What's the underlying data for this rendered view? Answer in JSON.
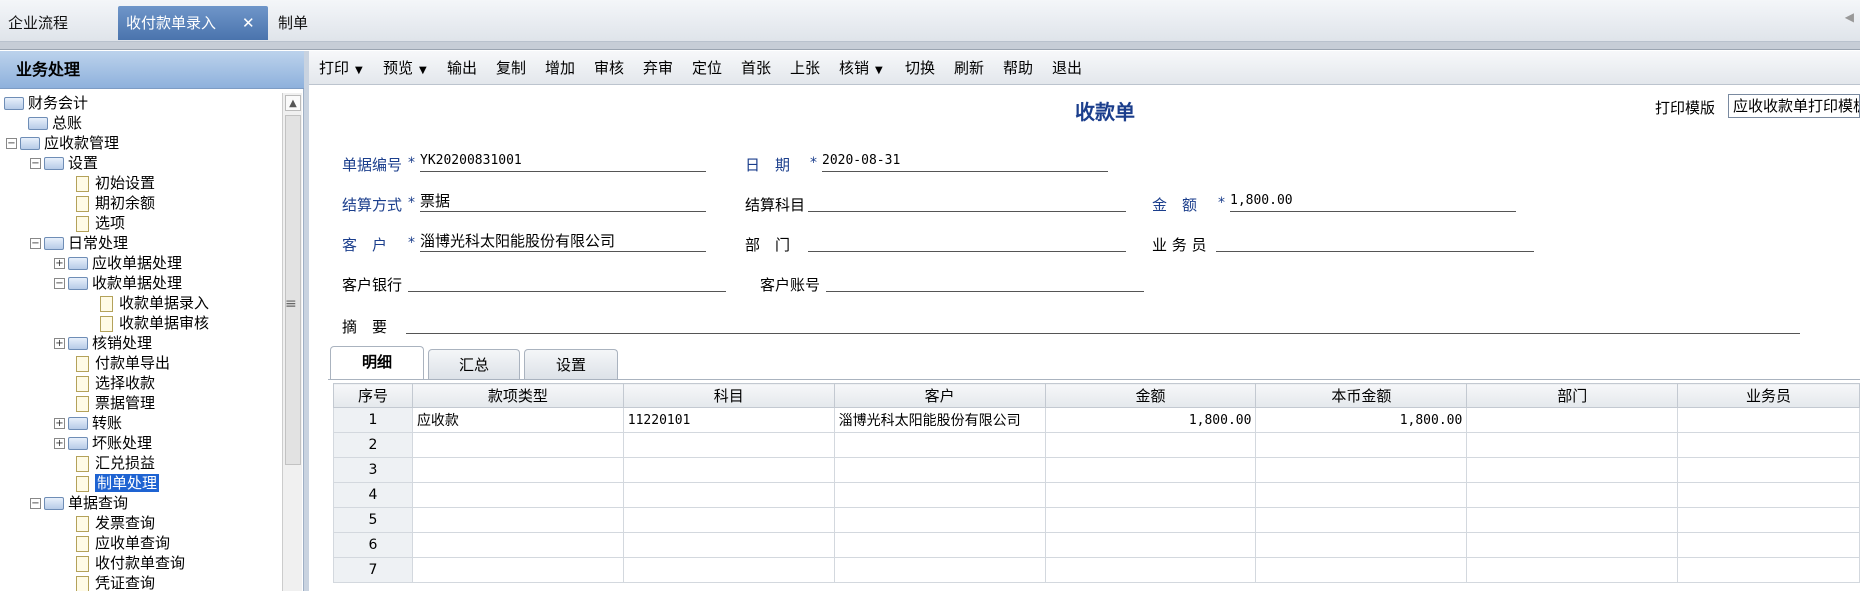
{
  "tabs": [
    {
      "label": "企业流程"
    },
    {
      "label": "收付款单录入",
      "close": "✕"
    },
    {
      "label": "制单"
    }
  ],
  "tab_arrow": "◀",
  "sidebar": {
    "title": "业务处理",
    "tree": [
      {
        "label": "财务会计",
        "toggle": ""
      },
      {
        "label": "总账",
        "toggle": ""
      },
      {
        "label": "应收款管理",
        "toggle": "−"
      },
      {
        "label": "设置",
        "toggle": "−"
      },
      {
        "label": "初始设置"
      },
      {
        "label": "期初余额"
      },
      {
        "label": "选项"
      },
      {
        "label": "日常处理",
        "toggle": "−"
      },
      {
        "label": "应收单据处理",
        "toggle": "+"
      },
      {
        "label": "收款单据处理",
        "toggle": "−"
      },
      {
        "label": "收款单据录入"
      },
      {
        "label": "收款单据审核"
      },
      {
        "label": "核销处理",
        "toggle": "+"
      },
      {
        "label": "付款单导出"
      },
      {
        "label": "选择收款"
      },
      {
        "label": "票据管理"
      },
      {
        "label": "转账",
        "toggle": "+"
      },
      {
        "label": "坏账处理",
        "toggle": "+"
      },
      {
        "label": "汇兑损益"
      },
      {
        "label": "制单处理"
      },
      {
        "label": "单据查询",
        "toggle": "−"
      },
      {
        "label": "发票查询"
      },
      {
        "label": "应收单查询"
      },
      {
        "label": "收付款单查询"
      },
      {
        "label": "凭证查询"
      }
    ],
    "selected": "制单处理",
    "grip": "≡"
  },
  "toolbar": {
    "print": "打印",
    "preview": "预览",
    "export": "输出",
    "copy": "复制",
    "add": "增加",
    "audit": "审核",
    "unaudit": "弃审",
    "locate": "定位",
    "first": "首张",
    "prev": "上张",
    "writeoff": "核销",
    "switch": "切换",
    "refresh": "刷新",
    "help": "帮助",
    "exit": "退出",
    "dd": "▼"
  },
  "form": {
    "title": "收款单",
    "template_label": "打印模版",
    "template_value": "应收收款单打印模板",
    "doc_no_label": "单据编号",
    "doc_no": "YK20200831001",
    "date_label": "日　期",
    "date": "2020-08-31",
    "settle_label": "结算方式",
    "settle": "票据",
    "subject_label": "结算科目",
    "subject": "",
    "amount_label": "金　额",
    "amount": "1,800.00",
    "customer_label": "客　户",
    "customer": "淄博光科太阳能股份有限公司",
    "dept_label": "部　门",
    "dept": "",
    "salesman_label": "业 务 员",
    "salesman": "",
    "bank_label": "客户银行",
    "bank": "",
    "account_label": "客户账号",
    "account": "",
    "memo_label": "摘　要",
    "memo": "",
    "star": "*"
  },
  "detail_tabs": [
    "明细",
    "汇总",
    "设置"
  ],
  "grid": {
    "headers": [
      "序号",
      "款项类型",
      "科目",
      "客户",
      "金额",
      "本币金额",
      "部门",
      "业务员"
    ],
    "rows": [
      [
        "1",
        "应收款",
        "11220101",
        "淄博光科太阳能股份有限公司",
        "1,800.00",
        "1,800.00",
        "",
        ""
      ],
      [
        "2",
        "",
        "",
        "",
        "",
        "",
        "",
        ""
      ],
      [
        "3",
        "",
        "",
        "",
        "",
        "",
        "",
        ""
      ],
      [
        "4",
        "",
        "",
        "",
        "",
        "",
        "",
        ""
      ],
      [
        "5",
        "",
        "",
        "",
        "",
        "",
        "",
        ""
      ],
      [
        "6",
        "",
        "",
        "",
        "",
        "",
        "",
        ""
      ],
      [
        "7",
        "",
        "",
        "",
        "",
        "",
        "",
        ""
      ]
    ]
  }
}
